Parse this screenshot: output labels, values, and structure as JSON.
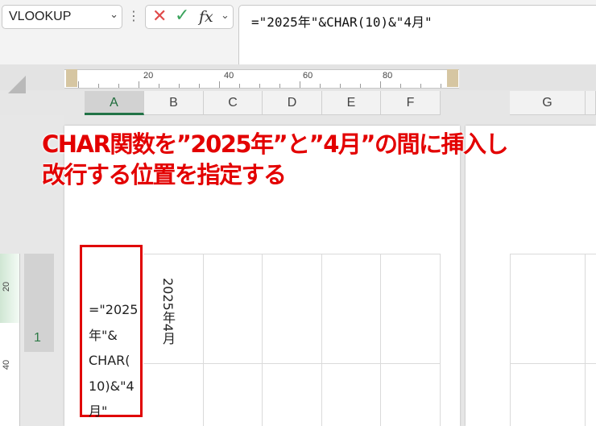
{
  "namebox": {
    "value": "VLOOKUP",
    "chevron_icon": "chevron-down-icon"
  },
  "formula_bar": {
    "cancel_icon": "x-icon",
    "enter_icon": "check-icon",
    "fx_label": "fx",
    "formula": "=\"2025年\"&CHAR(10)&\"4月\""
  },
  "ruler": {
    "labels": [
      "20",
      "40",
      "60",
      "80"
    ]
  },
  "vertical_ruler": {
    "labels": [
      "20",
      "40"
    ]
  },
  "columns": [
    "A",
    "B",
    "C",
    "D",
    "E",
    "F",
    "G"
  ],
  "active_column": "A",
  "rows": {
    "visible_row": "1"
  },
  "cells": {
    "A1": "=\"2025\n年\"&\nCHAR(\n10)&\"4\n月\"",
    "B1": "2025年4月"
  },
  "annotation": {
    "line1": "CHAR関数を”2025年”と”4月”の間に挿入し",
    "line2": "改行する位置を指定する",
    "color": "#e30000"
  },
  "colors": {
    "accent_green": "#217346",
    "highlight_red": "#e00000"
  }
}
